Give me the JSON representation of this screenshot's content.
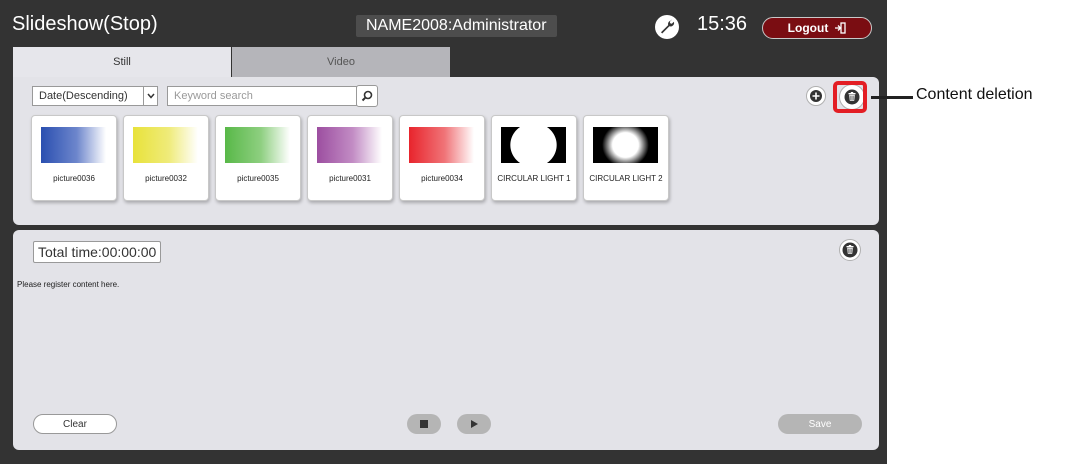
{
  "header": {
    "title": "Slideshow(Stop)",
    "user": "NAME2008:Administrator",
    "clock": "15:36",
    "logout_label": "Logout",
    "settings_icon": "wrench-icon",
    "logout_icon": "exit-door-icon"
  },
  "tabs": [
    {
      "label": "Still",
      "active": true
    },
    {
      "label": "Video",
      "active": false
    }
  ],
  "library": {
    "sort_value": "Date(Descending)",
    "search_placeholder": "Keyword search",
    "items": [
      {
        "name": "picture0036",
        "color": "#2a4fb0"
      },
      {
        "name": "picture0032",
        "color": "#e8e23a"
      },
      {
        "name": "picture0035",
        "color": "#58b848"
      },
      {
        "name": "picture0031",
        "color": "#9c4ea0"
      },
      {
        "name": "picture0034",
        "color": "#e8242c"
      },
      {
        "name": "CIRCULAR LIGHT 1",
        "color": "#000000"
      },
      {
        "name": "CIRCULAR LIGHT 2",
        "color": "#000000"
      }
    ]
  },
  "playlist": {
    "total_time": "Total time:00:00:00",
    "empty_message": "Please register content here.",
    "clear_label": "Clear",
    "save_label": "Save"
  },
  "annotation": {
    "label": "Content deletion",
    "color": "#e31e24"
  },
  "colors": {
    "app_bg": "#333333",
    "panel_bg": "#e3e3e8",
    "logout_bg": "#7a0d12"
  }
}
